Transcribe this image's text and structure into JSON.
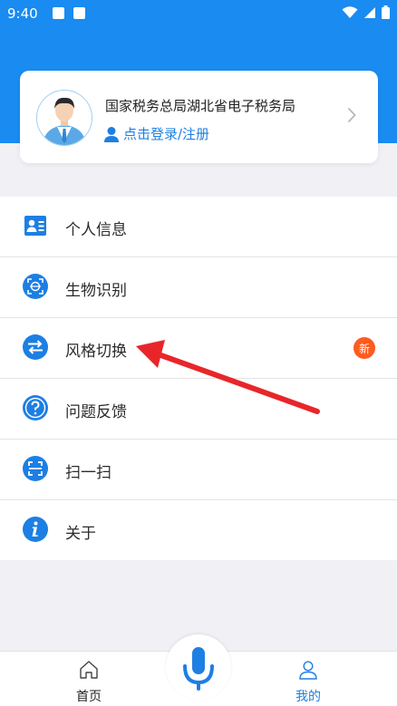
{
  "status_bar": {
    "time": "9:40"
  },
  "profile": {
    "org_name": "国家税务总局湖北省电子税务局",
    "login_text": "点击登录/注册"
  },
  "menu": {
    "items": [
      {
        "label": "个人信息"
      },
      {
        "label": "生物识别"
      },
      {
        "label": "风格切换",
        "badge": "新"
      },
      {
        "label": "问题反馈"
      },
      {
        "label": "扫一扫"
      },
      {
        "label": "关于"
      }
    ]
  },
  "bottom_nav": {
    "home_label": "首页",
    "mine_label": "我的"
  },
  "colors": {
    "primary_blue": "#1a8bf0",
    "badge_orange": "#ff5a1f",
    "annotation_red": "#e8262a"
  }
}
